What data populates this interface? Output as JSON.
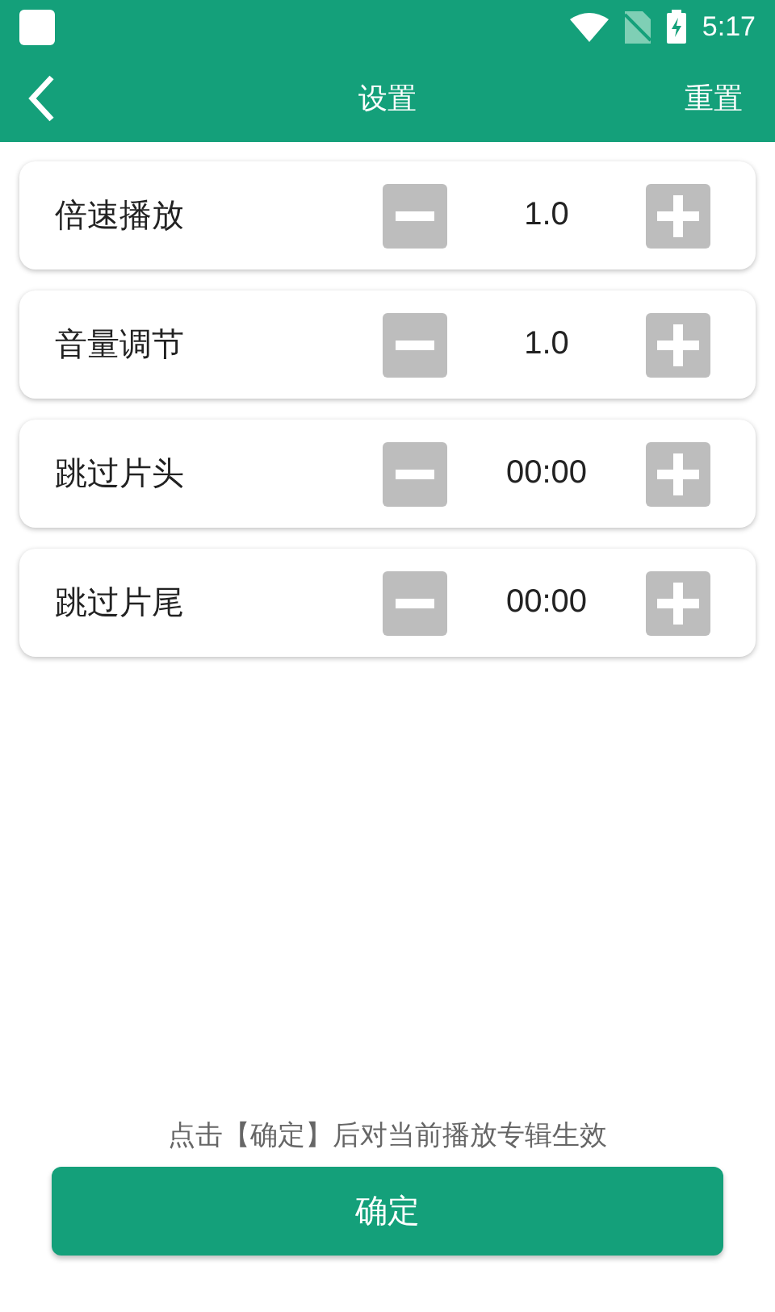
{
  "status_bar": {
    "time": "5:17"
  },
  "app_bar": {
    "title": "设置",
    "action": "重置"
  },
  "settings": [
    {
      "label": "倍速播放",
      "value": "1.0"
    },
    {
      "label": "音量调节",
      "value": "1.0"
    },
    {
      "label": "跳过片头",
      "value": "00:00"
    },
    {
      "label": "跳过片尾",
      "value": "00:00"
    }
  ],
  "hint": "点击【确定】后对当前播放专辑生效",
  "confirm_button": "确定"
}
